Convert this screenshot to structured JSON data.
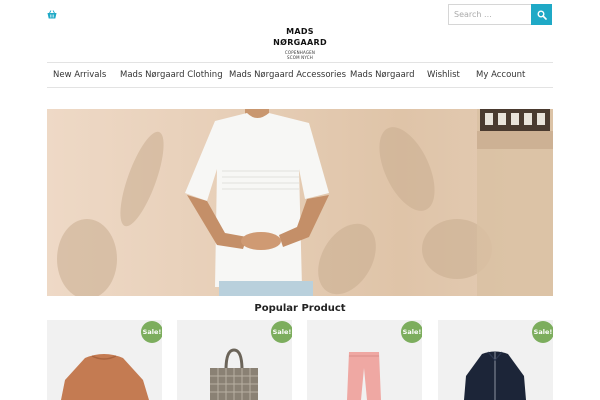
{
  "header": {
    "cart_icon": "basket-icon",
    "search": {
      "placeholder": "Search ...",
      "icon": "search-icon",
      "accent": "#1fa9c6"
    }
  },
  "logo": {
    "line1": "MADS",
    "line2": "NØRGAARD",
    "line3": "COPENHAGEN",
    "line4": "SCOM NYCH"
  },
  "nav": {
    "items": [
      {
        "label": "New Arrivals"
      },
      {
        "label": "Mads Nørgaard Clothing"
      },
      {
        "label": "Mads Nørgaard Accessories"
      },
      {
        "label": "Mads Nørgaard"
      },
      {
        "label": "Wishlist"
      },
      {
        "label": "My Account"
      }
    ]
  },
  "hero": {
    "image": "man-in-white-tshirt-photo"
  },
  "popular": {
    "title": "Popular Product",
    "badge_color": "#7cad5d",
    "products": [
      {
        "badge": "Sale!",
        "image": "orange-sweater"
      },
      {
        "badge": "Sale!",
        "image": "quilted-tote-bag"
      },
      {
        "badge": "Sale!",
        "image": "pink-trousers"
      },
      {
        "badge": "Sale!",
        "image": "navy-zip-jacket"
      }
    ]
  }
}
